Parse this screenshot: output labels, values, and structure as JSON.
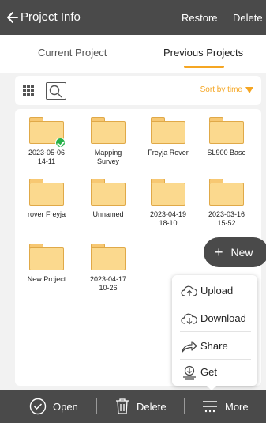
{
  "header": {
    "title": "Project Info",
    "restore_label": "Restore",
    "delete_label": "Delete"
  },
  "tabs": [
    {
      "label": "Current Project",
      "active": false
    },
    {
      "label": "Previous Projects",
      "active": true
    }
  ],
  "toolbar": {
    "sort_label": "Sort by time",
    "accent_color": "#f5a623"
  },
  "projects": [
    {
      "label": "2023-05-06\n14-11",
      "checked": true
    },
    {
      "label": "Mapping\nSurvey",
      "checked": false
    },
    {
      "label": "Freyja Rover",
      "checked": false
    },
    {
      "label": "SL900 Base",
      "checked": false
    },
    {
      "label": "rover Freyja",
      "checked": false
    },
    {
      "label": "Unnamed",
      "checked": false
    },
    {
      "label": "2023-04-19\n18-10",
      "checked": false
    },
    {
      "label": "2023-03-16\n15-52",
      "checked": false
    },
    {
      "label": "New Project",
      "checked": false
    },
    {
      "label": "2023-04-17\n10-26",
      "checked": false
    }
  ],
  "new_button": {
    "label": "New"
  },
  "more_menu": [
    {
      "label": "Upload",
      "icon": "cloud-upload-icon"
    },
    {
      "label": "Download",
      "icon": "cloud-download-icon"
    },
    {
      "label": "Share",
      "icon": "share-icon"
    },
    {
      "label": "Get",
      "icon": "get-icon"
    }
  ],
  "bottom_bar": {
    "open_label": "Open",
    "delete_label": "Delete",
    "more_label": "More"
  }
}
